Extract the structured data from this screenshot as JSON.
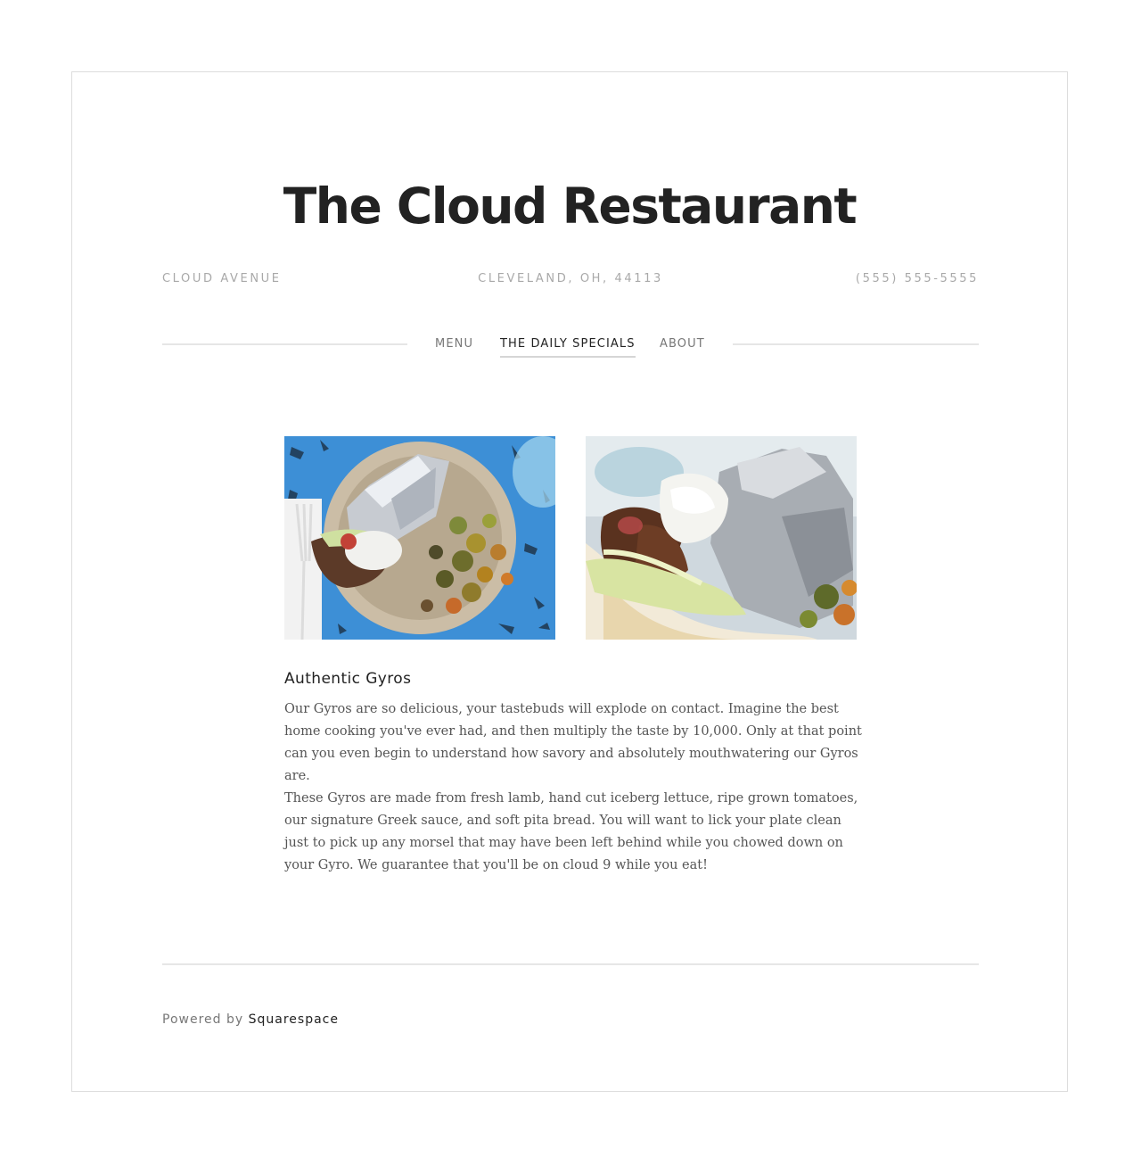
{
  "site": {
    "title": "The Cloud Restaurant",
    "address": "CLOUD AVENUE",
    "city": "CLEVELAND, OH, 44113",
    "phone": "(555) 555-5555"
  },
  "nav": {
    "items": [
      {
        "label": "MENU",
        "active": false
      },
      {
        "label": "THE DAILY SPECIALS",
        "active": true
      },
      {
        "label": "ABOUT",
        "active": false
      }
    ]
  },
  "post": {
    "images": [
      {
        "icon": "gyro-plate-photo"
      },
      {
        "icon": "gyro-closeup-photo"
      }
    ],
    "title": "Authentic Gyros",
    "paragraphs": [
      "Our Gyros are so delicious, your tastebuds will explode on contact. Imagine the best home cooking you've ever had, and then multiply the taste by 10,000. Only at that point can you even begin to understand how savory and absolutely mouthwatering our Gyros are.",
      "These Gyros are made from fresh lamb, hand cut iceberg lettuce, ripe grown tomatoes, our signature Greek sauce, and soft pita bread. You will want to lick your plate clean just to pick up any morsel that may have been left behind while you chowed down on your Gyro. We guarantee that you'll be on cloud 9 while you eat!"
    ]
  },
  "footer": {
    "prefix": "Powered by",
    "link": "Squarespace"
  },
  "colors": {
    "text_dark": "#222222",
    "text_muted": "#a9a9a9",
    "body_text": "#555555",
    "rule": "#e6e6e6",
    "tablecloth_blue": "#3d8fd6"
  }
}
